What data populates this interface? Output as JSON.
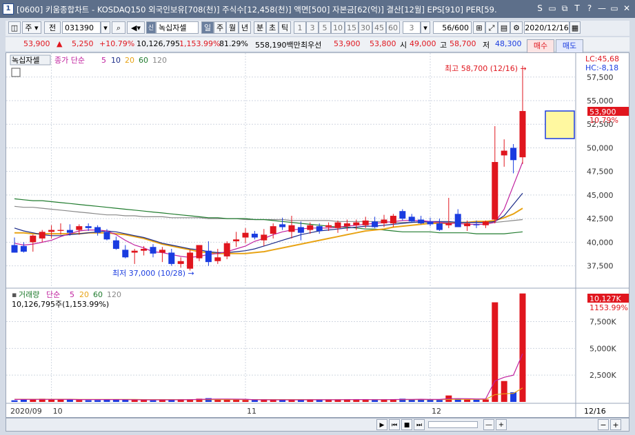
{
  "window": {
    "title": "[0600] 키움종합차트 - KOSDAQ150 외국인보유[708(천)] 주식수[12,458(천)] 액면[500] 자본금[62(억)] 결산[12월] EPS[910] PER[59.",
    "badge": "1",
    "controls": [
      "S",
      "▭",
      "⧉",
      "T",
      "?",
      "—",
      "▭",
      "✕"
    ]
  },
  "toolbar": {
    "type_label": "주",
    "prev_label": "전",
    "code": "031390",
    "name": "녹십자셀",
    "name_badge": "신",
    "periods": [
      "일",
      "주",
      "월",
      "년",
      "분",
      "초",
      "틱"
    ],
    "minutes": [
      "1",
      "3",
      "5",
      "10",
      "15",
      "30",
      "45",
      "60"
    ],
    "step": "3",
    "count": "56/600",
    "date": "2020/12/16"
  },
  "quote": {
    "price": "53,900",
    "up_mark": "▲",
    "change": "5,250",
    "rate": "+10.79%",
    "volume": "10,126,795",
    "vol_rate": "1,153.99%",
    "turnover": "81.29%",
    "amount": "558,190백만",
    "best_label": "최우선",
    "ask": "53,900",
    "bid": "53,800",
    "open_label": "시",
    "open": "49,000",
    "high_label": "고",
    "high": "58,700",
    "low_label": "저",
    "low": "48,300",
    "buy_label": "매수",
    "sell_label": "매도"
  },
  "price_panel": {
    "name_tag": "녹십자셀",
    "ma_legend": {
      "label": "종가 단순",
      "periods": [
        "5",
        "10",
        "20",
        "60",
        "120"
      ]
    },
    "lc": "LC:45,68",
    "hc": "HC:-8,18",
    "high_annotation": "최고 58,700 (12/16) →",
    "low_annotation": "최저 37,000 (10/28) →",
    "last_price_tag": "53,900",
    "last_rate_tag": "10.79%"
  },
  "volume_panel": {
    "ma_legend": {
      "label": "거래량",
      "sub": "단순",
      "periods": [
        "5",
        "20",
        "60",
        "120"
      ]
    },
    "value": "10,126,795주(1,153.99%)",
    "last_tag": "10,127K",
    "last_rate_tag": "1153.99%"
  },
  "x_axis": {
    "labels": [
      {
        "text": "2020/09",
        "i": 0
      },
      {
        "text": "10",
        "i": 4
      },
      {
        "text": "11",
        "i": 25
      },
      {
        "text": "12",
        "i": 45
      }
    ],
    "end_label": "12/16"
  },
  "scroll": {
    "buttons": [
      "▶",
      "⏮",
      "■",
      "⏭",
      "—",
      "+",
      "−",
      "+"
    ]
  },
  "colors": {
    "up": "#e0161e",
    "down": "#1a3ce0",
    "ma5": "#c0209e",
    "ma10": "#1a2a88",
    "ma20": "#e8a314",
    "ma60": "#1e7a2c",
    "ma120": "#888888"
  },
  "chart_data": [
    {
      "type": "candlestick",
      "y_ticks": [
        37500,
        40000,
        42500,
        45000,
        47500,
        50000,
        52500,
        55000,
        57500
      ],
      "ylim": [
        35500,
        59600
      ],
      "candles": [
        {
          "o": 39700,
          "h": 40500,
          "l": 38900,
          "c": 38900
        },
        {
          "o": 39600,
          "h": 40000,
          "l": 38900,
          "c": 39000
        },
        {
          "o": 40000,
          "h": 40800,
          "l": 39000,
          "c": 40700
        },
        {
          "o": 40400,
          "h": 41300,
          "l": 40000,
          "c": 41100
        },
        {
          "o": 41100,
          "h": 41800,
          "l": 40400,
          "c": 41300
        },
        {
          "o": 41200,
          "h": 42000,
          "l": 40800,
          "c": 41300
        },
        {
          "o": 41300,
          "h": 41900,
          "l": 40700,
          "c": 41000
        },
        {
          "o": 41300,
          "h": 41900,
          "l": 40800,
          "c": 41700
        },
        {
          "o": 41700,
          "h": 42000,
          "l": 41200,
          "c": 41500
        },
        {
          "o": 41600,
          "h": 41800,
          "l": 40700,
          "c": 41000
        },
        {
          "o": 41100,
          "h": 41400,
          "l": 40200,
          "c": 40300
        },
        {
          "o": 40200,
          "h": 40600,
          "l": 39200,
          "c": 39300
        },
        {
          "o": 39200,
          "h": 39700,
          "l": 38300,
          "c": 38400
        },
        {
          "o": 38900,
          "h": 39300,
          "l": 37700,
          "c": 39100
        },
        {
          "o": 39100,
          "h": 39600,
          "l": 38600,
          "c": 39300
        },
        {
          "o": 39500,
          "h": 39800,
          "l": 38400,
          "c": 38800
        },
        {
          "o": 38900,
          "h": 39500,
          "l": 37900,
          "c": 39200
        },
        {
          "o": 38900,
          "h": 39300,
          "l": 37500,
          "c": 37700
        },
        {
          "o": 37700,
          "h": 38400,
          "l": 37300,
          "c": 38000
        },
        {
          "o": 37200,
          "h": 39200,
          "l": 37000,
          "c": 38900
        },
        {
          "o": 38300,
          "h": 39700,
          "l": 38000,
          "c": 39700
        },
        {
          "o": 39100,
          "h": 40100,
          "l": 37500,
          "c": 37900
        },
        {
          "o": 38000,
          "h": 39300,
          "l": 37700,
          "c": 38400
        },
        {
          "o": 38500,
          "h": 40100,
          "l": 38200,
          "c": 39900
        },
        {
          "o": 40100,
          "h": 41100,
          "l": 39500,
          "c": 40300
        },
        {
          "o": 40500,
          "h": 41500,
          "l": 39900,
          "c": 41000
        },
        {
          "o": 40900,
          "h": 41200,
          "l": 40300,
          "c": 40500
        },
        {
          "o": 40200,
          "h": 41400,
          "l": 39600,
          "c": 40800
        },
        {
          "o": 40900,
          "h": 42000,
          "l": 40400,
          "c": 41700
        },
        {
          "o": 41900,
          "h": 42600,
          "l": 41300,
          "c": 41600
        },
        {
          "o": 41100,
          "h": 42800,
          "l": 40400,
          "c": 41800
        },
        {
          "o": 41600,
          "h": 42200,
          "l": 40200,
          "c": 41000
        },
        {
          "o": 41300,
          "h": 42100,
          "l": 40900,
          "c": 41800
        },
        {
          "o": 41700,
          "h": 42000,
          "l": 40900,
          "c": 41200
        },
        {
          "o": 41600,
          "h": 42100,
          "l": 41200,
          "c": 41800
        },
        {
          "o": 41500,
          "h": 42300,
          "l": 41000,
          "c": 42100
        },
        {
          "o": 41700,
          "h": 42400,
          "l": 41200,
          "c": 42000
        },
        {
          "o": 41800,
          "h": 42400,
          "l": 41300,
          "c": 42100
        },
        {
          "o": 41800,
          "h": 42700,
          "l": 41500,
          "c": 42300
        },
        {
          "o": 42200,
          "h": 42700,
          "l": 41500,
          "c": 41600
        },
        {
          "o": 42000,
          "h": 42900,
          "l": 41600,
          "c": 42400
        },
        {
          "o": 42000,
          "h": 43000,
          "l": 41600,
          "c": 42800
        },
        {
          "o": 43300,
          "h": 43500,
          "l": 42300,
          "c": 42500
        },
        {
          "o": 42700,
          "h": 43000,
          "l": 42100,
          "c": 42200
        },
        {
          "o": 42400,
          "h": 42800,
          "l": 41900,
          "c": 42000
        },
        {
          "o": 42200,
          "h": 42600,
          "l": 41700,
          "c": 41900
        },
        {
          "o": 42000,
          "h": 42500,
          "l": 41200,
          "c": 41300
        },
        {
          "o": 41800,
          "h": 44700,
          "l": 41500,
          "c": 42000
        },
        {
          "o": 43000,
          "h": 43500,
          "l": 41600,
          "c": 41600
        },
        {
          "o": 41700,
          "h": 42300,
          "l": 41200,
          "c": 42000
        },
        {
          "o": 41900,
          "h": 42300,
          "l": 41500,
          "c": 41800
        },
        {
          "o": 41800,
          "h": 42300,
          "l": 41500,
          "c": 42200
        },
        {
          "o": 42400,
          "h": 52300,
          "l": 42000,
          "c": 48500
        },
        {
          "o": 49200,
          "h": 50900,
          "l": 48000,
          "c": 49700
        },
        {
          "o": 50000,
          "h": 50400,
          "l": 47300,
          "c": 48700
        },
        {
          "o": 49000,
          "h": 58700,
          "l": 48300,
          "c": 53900
        }
      ],
      "ma5": [
        39900,
        39700,
        39800,
        40000,
        40200,
        40600,
        40900,
        41200,
        41300,
        41300,
        41200,
        40800,
        40200,
        39700,
        39400,
        39000,
        38900,
        38700,
        38500,
        38400,
        38500,
        38700,
        38800,
        39000,
        39300,
        39600,
        40100,
        40400,
        40800,
        41100,
        41300,
        41400,
        41500,
        41500,
        41500,
        41600,
        41700,
        41800,
        41900,
        42000,
        42100,
        42200,
        42300,
        42300,
        42300,
        42200,
        42100,
        42000,
        42000,
        41900,
        41900,
        41900,
        42100,
        43500,
        46000,
        48500
      ],
      "ma10": [
        41500,
        41200,
        41000,
        40800,
        40700,
        40700,
        40800,
        40900,
        41000,
        41100,
        41200,
        41100,
        40900,
        40700,
        40500,
        40200,
        39900,
        39700,
        39500,
        39300,
        39200,
        39000,
        38900,
        38900,
        39000,
        39100,
        39300,
        39600,
        39900,
        40200,
        40500,
        40800,
        41000,
        41200,
        41300,
        41400,
        41500,
        41600,
        41700,
        41700,
        41800,
        41900,
        42000,
        42100,
        42200,
        42200,
        42200,
        42200,
        42100,
        42100,
        42100,
        42100,
        42200,
        42800,
        44000,
        45200
      ],
      "ma20": [
        41000,
        41000,
        40900,
        40900,
        40900,
        40900,
        40900,
        40900,
        41000,
        41000,
        41000,
        40900,
        40800,
        40600,
        40400,
        40100,
        39800,
        39600,
        39400,
        39200,
        39000,
        38900,
        38800,
        38800,
        38800,
        38800,
        38900,
        39000,
        39200,
        39400,
        39600,
        39800,
        40000,
        40200,
        40400,
        40600,
        40800,
        41000,
        41200,
        41300,
        41400,
        41600,
        41700,
        41800,
        41900,
        42000,
        42000,
        42000,
        42100,
        42100,
        42200,
        42200,
        42300,
        42600,
        43000,
        43600
      ],
      "ma60": [
        44600,
        44500,
        44400,
        44400,
        44300,
        44200,
        44100,
        44000,
        43900,
        43800,
        43700,
        43600,
        43500,
        43400,
        43300,
        43200,
        43100,
        43000,
        42900,
        42800,
        42700,
        42600,
        42600,
        42500,
        42500,
        42500,
        42400,
        42400,
        42300,
        42200,
        42100,
        42000,
        41900,
        41800,
        41700,
        41600,
        41600,
        41500,
        41400,
        41400,
        41300,
        41200,
        41100,
        41100,
        41100,
        41100,
        41000,
        41000,
        41000,
        41000,
        40900,
        40900,
        40900,
        40900,
        41000,
        41100
      ],
      "ma120": [
        43800,
        43700,
        43700,
        43600,
        43500,
        43400,
        43300,
        43200,
        43100,
        43000,
        42900,
        42900,
        42800,
        42800,
        42700,
        42700,
        42700,
        42600,
        42600,
        42600,
        42600,
        42500,
        42500,
        42500,
        42500,
        42400,
        42400,
        42400,
        42400,
        42400,
        42300,
        42300,
        42300,
        42300,
        42300,
        42200,
        42200,
        42200,
        42200,
        42200,
        42200,
        42100,
        42100,
        42100,
        42100,
        42100,
        42100,
        42100,
        42100,
        42100,
        42100,
        42100,
        42100,
        42200,
        42300,
        42400
      ]
    },
    {
      "type": "bar",
      "y_ticks": [
        2500,
        5000,
        7500
      ],
      "y_tick_labels": [
        "2,500K",
        "5,000K",
        "7,500K"
      ],
      "ylim": [
        0,
        10300
      ],
      "values": [
        150,
        200,
        260,
        300,
        280,
        220,
        200,
        180,
        160,
        170,
        230,
        200,
        250,
        180,
        160,
        150,
        200,
        220,
        240,
        260,
        300,
        350,
        220,
        200,
        250,
        180,
        170,
        160,
        230,
        200,
        220,
        180,
        200,
        190,
        210,
        230,
        250,
        230,
        200,
        180,
        220,
        260,
        300,
        250,
        220,
        200,
        180,
        600,
        280,
        220,
        200,
        230,
        9300,
        1950,
        900,
        10127
      ],
      "ma5": [
        230,
        230,
        240,
        240,
        240,
        240,
        230,
        220,
        220,
        220,
        220,
        220,
        210,
        200,
        190,
        190,
        190,
        190,
        200,
        210,
        230,
        260,
        270,
        270,
        260,
        250,
        200,
        200,
        190,
        190,
        190,
        190,
        200,
        200,
        200,
        200,
        210,
        220,
        220,
        210,
        210,
        220,
        240,
        240,
        250,
        240,
        230,
        300,
        310,
        300,
        280,
        280,
        1960,
        2300,
        2500,
        4500
      ],
      "ma20": [
        250,
        250,
        250,
        250,
        250,
        250,
        250,
        240,
        240,
        240,
        230,
        230,
        230,
        230,
        220,
        220,
        220,
        220,
        220,
        220,
        220,
        220,
        220,
        220,
        220,
        220,
        220,
        220,
        220,
        220,
        220,
        220,
        220,
        210,
        210,
        210,
        210,
        210,
        210,
        210,
        210,
        210,
        210,
        220,
        220,
        220,
        220,
        240,
        240,
        240,
        240,
        240,
        680,
        760,
        800,
        1300
      ]
    }
  ]
}
